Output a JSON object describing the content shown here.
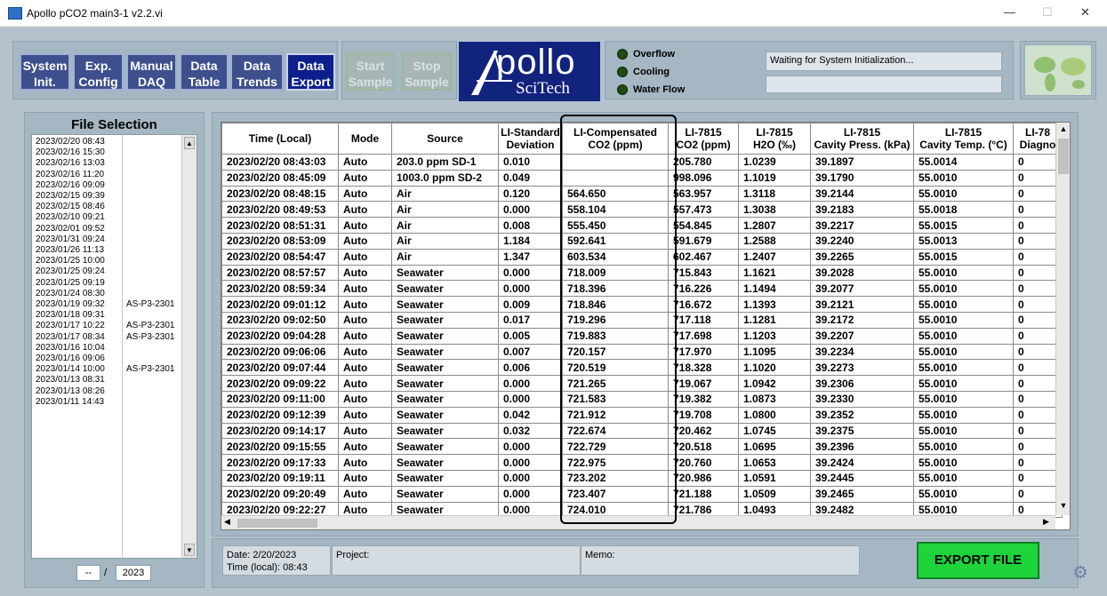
{
  "window": {
    "title": "Apollo pCO2 main3-1 v2.2.vi",
    "minimize": "—",
    "maximize": "☐",
    "close": "✕"
  },
  "nav": [
    {
      "id": "system-init",
      "l1": "System",
      "l2": "Init."
    },
    {
      "id": "exp-config",
      "l1": "Exp.",
      "l2": "Config"
    },
    {
      "id": "manual-daq",
      "l1": "Manual",
      "l2": "DAQ"
    },
    {
      "id": "data-table",
      "l1": "Data",
      "l2": "Table"
    },
    {
      "id": "data-trends",
      "l1": "Data",
      "l2": "Trends"
    },
    {
      "id": "data-export",
      "l1": "Data",
      "l2": "Export"
    }
  ],
  "sample_buttons": [
    {
      "id": "start-sample",
      "l1": "Start",
      "l2": "Sample"
    },
    {
      "id": "stop-sample",
      "l1": "Stop",
      "l2": "Sample"
    }
  ],
  "logo": {
    "main": "pollo",
    "sub": "SciTech"
  },
  "indicators": [
    "Overflow",
    "Cooling",
    "Water Flow"
  ],
  "status": {
    "message": "Waiting for System Initialization...",
    "secondary": ""
  },
  "file_selection": {
    "title": "File Selection",
    "items": [
      {
        "date": "2023/02/20 08:43",
        "tag": ""
      },
      {
        "date": "2023/02/16 15:30",
        "tag": ""
      },
      {
        "date": "2023/02/16 13:03",
        "tag": ""
      },
      {
        "date": "2023/02/16 11:20",
        "tag": ""
      },
      {
        "date": "2023/02/16 09:09",
        "tag": ""
      },
      {
        "date": "2023/02/15 09:39",
        "tag": ""
      },
      {
        "date": "2023/02/15 08:46",
        "tag": ""
      },
      {
        "date": "2023/02/10 09:21",
        "tag": ""
      },
      {
        "date": "2023/02/01 09:52",
        "tag": ""
      },
      {
        "date": "2023/01/31 09:24",
        "tag": ""
      },
      {
        "date": "2023/01/26 11:13",
        "tag": ""
      },
      {
        "date": "2023/01/25 10:00",
        "tag": ""
      },
      {
        "date": "2023/01/25 09:24",
        "tag": ""
      },
      {
        "date": "2023/01/25 09:19",
        "tag": ""
      },
      {
        "date": "2023/01/24 08:30",
        "tag": ""
      },
      {
        "date": "2023/01/19 09:32",
        "tag": "AS-P3-2301"
      },
      {
        "date": "2023/01/18 09:31",
        "tag": ""
      },
      {
        "date": "2023/01/17 10:22",
        "tag": "AS-P3-2301"
      },
      {
        "date": "2023/01/17 08:34",
        "tag": "AS-P3-2301"
      },
      {
        "date": "2023/01/16 10:04",
        "tag": ""
      },
      {
        "date": "2023/01/16 09:06",
        "tag": ""
      },
      {
        "date": "2023/01/14 10:00",
        "tag": "AS-P3-2301"
      },
      {
        "date": "2023/01/13 08:31",
        "tag": ""
      },
      {
        "date": "2023/01/13 08:26",
        "tag": ""
      },
      {
        "date": "2023/01/11 14:43",
        "tag": ""
      }
    ],
    "month": "--",
    "separator": "/",
    "year": "2023"
  },
  "table": {
    "headers": [
      [
        "Time (Local)",
        ""
      ],
      [
        "Mode",
        ""
      ],
      [
        "Source",
        ""
      ],
      [
        "LI-Standard",
        "Deviation"
      ],
      [
        "LI-Compensated",
        "CO2 (ppm)"
      ],
      [
        "LI-7815",
        "CO2 (ppm)"
      ],
      [
        "LI-7815",
        "H2O (‰)"
      ],
      [
        "LI-7815",
        "Cavity Press. (kPa)"
      ],
      [
        "LI-7815",
        "Cavity Temp. (°C)"
      ],
      [
        "LI-78",
        "Diagno"
      ]
    ],
    "rows": [
      [
        "2023/02/20  08:43:03",
        "Auto",
        "203.0 ppm SD-1",
        "0.010",
        "",
        "205.780",
        "1.0239",
        "39.1897",
        "55.0014",
        "0"
      ],
      [
        "2023/02/20  08:45:09",
        "Auto",
        "1003.0 ppm SD-2",
        "0.049",
        "",
        "998.096",
        "1.1019",
        "39.1790",
        "55.0010",
        "0"
      ],
      [
        "2023/02/20  08:48:15",
        "Auto",
        "Air",
        "0.120",
        "564.650",
        "563.957",
        "1.3118",
        "39.2144",
        "55.0010",
        "0"
      ],
      [
        "2023/02/20  08:49:53",
        "Auto",
        "Air",
        "0.000",
        "558.104",
        "557.473",
        "1.3038",
        "39.2183",
        "55.0018",
        "0"
      ],
      [
        "2023/02/20  08:51:31",
        "Auto",
        "Air",
        "0.008",
        "555.450",
        "554.845",
        "1.2807",
        "39.2217",
        "55.0015",
        "0"
      ],
      [
        "2023/02/20  08:53:09",
        "Auto",
        "Air",
        "1.184",
        "592.641",
        "591.679",
        "1.2588",
        "39.2240",
        "55.0013",
        "0"
      ],
      [
        "2023/02/20  08:54:47",
        "Auto",
        "Air",
        "1.347",
        "603.534",
        "602.467",
        "1.2407",
        "39.2265",
        "55.0015",
        "0"
      ],
      [
        "2023/02/20  08:57:57",
        "Auto",
        "Seawater",
        "0.000",
        "718.009",
        "715.843",
        "1.1621",
        "39.2028",
        "55.0010",
        "0"
      ],
      [
        "2023/02/20  08:59:34",
        "Auto",
        "Seawater",
        "0.000",
        "718.396",
        "716.226",
        "1.1494",
        "39.2077",
        "55.0010",
        "0"
      ],
      [
        "2023/02/20  09:01:12",
        "Auto",
        "Seawater",
        "0.009",
        "718.846",
        "716.672",
        "1.1393",
        "39.2121",
        "55.0010",
        "0"
      ],
      [
        "2023/02/20  09:02:50",
        "Auto",
        "Seawater",
        "0.017",
        "719.296",
        "717.118",
        "1.1281",
        "39.2172",
        "55.0010",
        "0"
      ],
      [
        "2023/02/20  09:04:28",
        "Auto",
        "Seawater",
        "0.005",
        "719.883",
        "717.698",
        "1.1203",
        "39.2207",
        "55.0010",
        "0"
      ],
      [
        "2023/02/20  09:06:06",
        "Auto",
        "Seawater",
        "0.007",
        "720.157",
        "717.970",
        "1.1095",
        "39.2234",
        "55.0010",
        "0"
      ],
      [
        "2023/02/20  09:07:44",
        "Auto",
        "Seawater",
        "0.006",
        "720.519",
        "718.328",
        "1.1020",
        "39.2273",
        "55.0010",
        "0"
      ],
      [
        "2023/02/20  09:09:22",
        "Auto",
        "Seawater",
        "0.000",
        "721.265",
        "719.067",
        "1.0942",
        "39.2306",
        "55.0010",
        "0"
      ],
      [
        "2023/02/20  09:11:00",
        "Auto",
        "Seawater",
        "0.000",
        "721.583",
        "719.382",
        "1.0873",
        "39.2330",
        "55.0010",
        "0"
      ],
      [
        "2023/02/20  09:12:39",
        "Auto",
        "Seawater",
        "0.042",
        "721.912",
        "719.708",
        "1.0800",
        "39.2352",
        "55.0010",
        "0"
      ],
      [
        "2023/02/20  09:14:17",
        "Auto",
        "Seawater",
        "0.032",
        "722.674",
        "720.462",
        "1.0745",
        "39.2375",
        "55.0010",
        "0"
      ],
      [
        "2023/02/20  09:15:55",
        "Auto",
        "Seawater",
        "0.000",
        "722.729",
        "720.518",
        "1.0695",
        "39.2396",
        "55.0010",
        "0"
      ],
      [
        "2023/02/20  09:17:33",
        "Auto",
        "Seawater",
        "0.000",
        "722.975",
        "720.760",
        "1.0653",
        "39.2424",
        "55.0010",
        "0"
      ],
      [
        "2023/02/20  09:19:11",
        "Auto",
        "Seawater",
        "0.000",
        "723.202",
        "720.986",
        "1.0591",
        "39.2445",
        "55.0010",
        "0"
      ],
      [
        "2023/02/20  09:20:49",
        "Auto",
        "Seawater",
        "0.000",
        "723.407",
        "721.188",
        "1.0509",
        "39.2465",
        "55.0010",
        "0"
      ],
      [
        "2023/02/20  09:22:27",
        "Auto",
        "Seawater",
        "0.000",
        "724.010",
        "721.786",
        "1.0493",
        "39.2482",
        "55.0010",
        "0"
      ]
    ]
  },
  "info": {
    "date": "Date: 2/20/2023",
    "time": "Time (local): 08:43",
    "project_label": "Project:",
    "memo_label": "Memo:"
  },
  "export_label": "EXPORT FILE",
  "colors": {
    "background": "#b3c2cc",
    "nav_active": "#0c1f8c",
    "export": "#1ed43b",
    "logo": "#12237e"
  }
}
